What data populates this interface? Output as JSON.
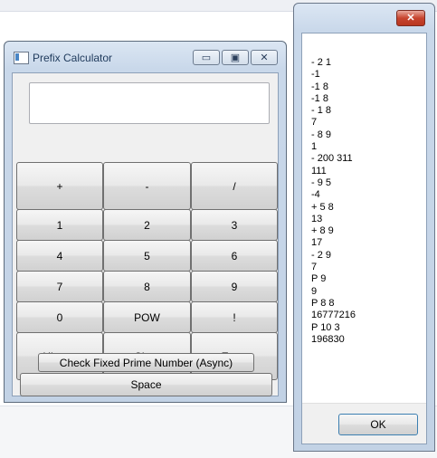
{
  "calculator": {
    "title": "Prefix Calculator",
    "caption_buttons": {
      "minimize": "▭",
      "maximize": "▣",
      "close": "✕"
    },
    "display_value": "",
    "keys": {
      "plus": "+",
      "minus": "-",
      "divide": "/",
      "one": "1",
      "two": "2",
      "three": "3",
      "four": "4",
      "five": "5",
      "six": "6",
      "seven": "7",
      "eight": "8",
      "nine": "9",
      "zero": "0",
      "pow": "POW",
      "factorial": "!",
      "history": "History",
      "clear": "Clear",
      "enter": "Enter"
    },
    "prime_button": "Check Fixed Prime Number (Async)",
    "space_button": "Space"
  },
  "history_dialog": {
    "close_label": "✕",
    "lines": [
      "- 2 1",
      "-1",
      "-1 8",
      "-1 8",
      "- 1 8",
      "7",
      "- 8 9",
      "1",
      "- 200 311",
      "111",
      "- 9 5",
      "-4",
      "+ 5 8",
      "13",
      "+ 8 9",
      "17",
      "- 2 9",
      "7",
      "P 9",
      "9",
      "P 8 8",
      "16777216",
      "P 10 3",
      "196830"
    ],
    "ok_label": "OK"
  }
}
